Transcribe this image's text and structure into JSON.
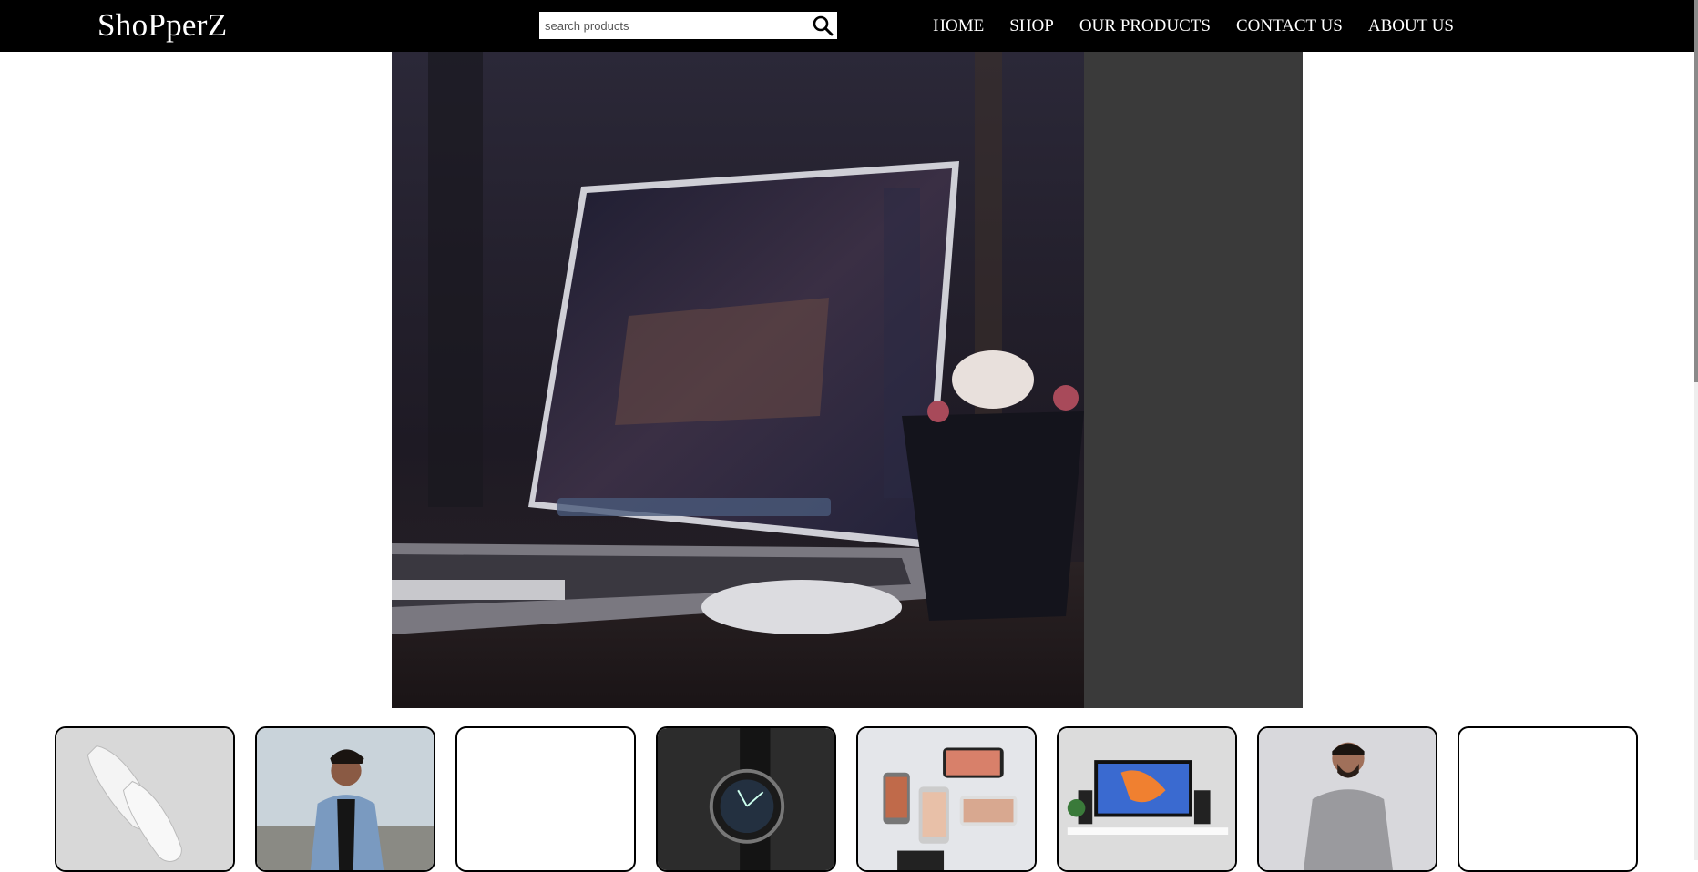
{
  "header": {
    "logo": "ShoPperZ",
    "search": {
      "placeholder": "search products",
      "icon": "search-icon"
    },
    "nav": [
      "HOME",
      "SHOP",
      "OUR PRODUCTS",
      "CONTACT US",
      "ABOUT US"
    ]
  },
  "hero": {
    "image": "laptop-on-desk-photo"
  },
  "products": [
    {
      "image": "white-sneakers-photo"
    },
    {
      "image": "man-denim-jacket-photo"
    },
    {
      "image": ""
    },
    {
      "image": "wristwatch-photo"
    },
    {
      "image": "smartphones-photo"
    },
    {
      "image": "desk-monitor-setup-photo"
    },
    {
      "image": "man-grey-hoodie-photo"
    },
    {
      "image": ""
    }
  ]
}
